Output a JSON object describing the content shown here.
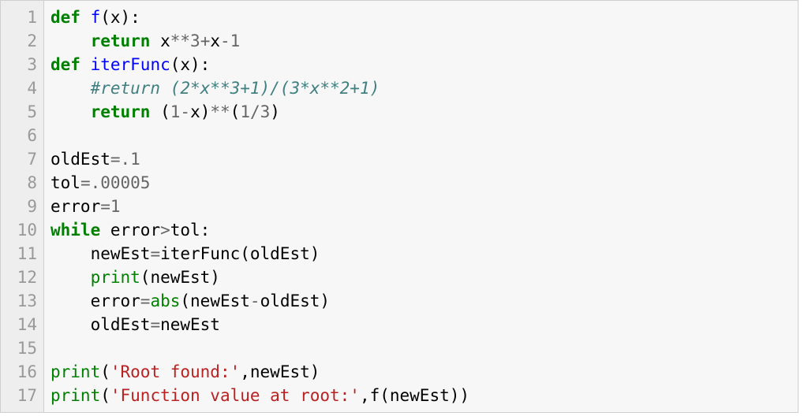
{
  "editor": {
    "language": "python",
    "line_count": 17,
    "gutter": [
      "1",
      "2",
      "3",
      "4",
      "5",
      "6",
      "7",
      "8",
      "9",
      "10",
      "11",
      "12",
      "13",
      "14",
      "15",
      "16",
      "17"
    ],
    "lines": [
      {
        "tokens": [
          {
            "t": "kw",
            "v": "def"
          },
          {
            "t": "sp",
            "v": " "
          },
          {
            "t": "fn",
            "v": "f"
          },
          {
            "t": "id",
            "v": "(x):"
          }
        ]
      },
      {
        "tokens": [
          {
            "t": "sp",
            "v": "    "
          },
          {
            "t": "kw",
            "v": "return"
          },
          {
            "t": "sp",
            "v": " "
          },
          {
            "t": "id",
            "v": "x"
          },
          {
            "t": "op",
            "v": "**"
          },
          {
            "t": "num",
            "v": "3"
          },
          {
            "t": "op",
            "v": "+"
          },
          {
            "t": "id",
            "v": "x"
          },
          {
            "t": "op",
            "v": "-"
          },
          {
            "t": "num",
            "v": "1"
          }
        ]
      },
      {
        "tokens": [
          {
            "t": "kw",
            "v": "def"
          },
          {
            "t": "sp",
            "v": " "
          },
          {
            "t": "fn",
            "v": "iterFunc"
          },
          {
            "t": "id",
            "v": "(x):"
          }
        ]
      },
      {
        "tokens": [
          {
            "t": "sp",
            "v": "    "
          },
          {
            "t": "cm",
            "v": "#return (2*x**3+1)/(3*x**2+1)"
          }
        ]
      },
      {
        "tokens": [
          {
            "t": "sp",
            "v": "    "
          },
          {
            "t": "kw",
            "v": "return"
          },
          {
            "t": "sp",
            "v": " "
          },
          {
            "t": "id",
            "v": "("
          },
          {
            "t": "num",
            "v": "1"
          },
          {
            "t": "op",
            "v": "-"
          },
          {
            "t": "id",
            "v": "x)"
          },
          {
            "t": "op",
            "v": "**"
          },
          {
            "t": "id",
            "v": "("
          },
          {
            "t": "num",
            "v": "1"
          },
          {
            "t": "op",
            "v": "/"
          },
          {
            "t": "num",
            "v": "3"
          },
          {
            "t": "id",
            "v": ")"
          }
        ]
      },
      {
        "tokens": [
          {
            "t": "sp",
            "v": ""
          }
        ]
      },
      {
        "tokens": [
          {
            "t": "id",
            "v": "oldEst"
          },
          {
            "t": "op",
            "v": "="
          },
          {
            "t": "num",
            "v": ".1"
          }
        ]
      },
      {
        "tokens": [
          {
            "t": "id",
            "v": "tol"
          },
          {
            "t": "op",
            "v": "="
          },
          {
            "t": "num",
            "v": ".00005"
          }
        ]
      },
      {
        "tokens": [
          {
            "t": "id",
            "v": "error"
          },
          {
            "t": "op",
            "v": "="
          },
          {
            "t": "num",
            "v": "1"
          }
        ]
      },
      {
        "tokens": [
          {
            "t": "kw",
            "v": "while"
          },
          {
            "t": "sp",
            "v": " "
          },
          {
            "t": "id",
            "v": "error"
          },
          {
            "t": "op",
            "v": ">"
          },
          {
            "t": "id",
            "v": "tol:"
          }
        ]
      },
      {
        "tokens": [
          {
            "t": "sp",
            "v": "    "
          },
          {
            "t": "id",
            "v": "newEst"
          },
          {
            "t": "op",
            "v": "="
          },
          {
            "t": "id",
            "v": "iterFunc(oldEst)"
          }
        ]
      },
      {
        "tokens": [
          {
            "t": "sp",
            "v": "    "
          },
          {
            "t": "bn",
            "v": "print"
          },
          {
            "t": "id",
            "v": "(newEst)"
          }
        ]
      },
      {
        "tokens": [
          {
            "t": "sp",
            "v": "    "
          },
          {
            "t": "id",
            "v": "error"
          },
          {
            "t": "op",
            "v": "="
          },
          {
            "t": "bn",
            "v": "abs"
          },
          {
            "t": "id",
            "v": "(newEst"
          },
          {
            "t": "op",
            "v": "-"
          },
          {
            "t": "id",
            "v": "oldEst)"
          }
        ]
      },
      {
        "tokens": [
          {
            "t": "sp",
            "v": "    "
          },
          {
            "t": "id",
            "v": "oldEst"
          },
          {
            "t": "op",
            "v": "="
          },
          {
            "t": "id",
            "v": "newEst"
          }
        ]
      },
      {
        "tokens": [
          {
            "t": "sp",
            "v": ""
          }
        ]
      },
      {
        "tokens": [
          {
            "t": "bn",
            "v": "print"
          },
          {
            "t": "id",
            "v": "("
          },
          {
            "t": "str",
            "v": "'Root found:'"
          },
          {
            "t": "id",
            "v": ",newEst)"
          }
        ]
      },
      {
        "tokens": [
          {
            "t": "bn",
            "v": "print"
          },
          {
            "t": "id",
            "v": "("
          },
          {
            "t": "str",
            "v": "'Function value at root:'"
          },
          {
            "t": "id",
            "v": ",f(newEst))"
          }
        ]
      }
    ]
  }
}
